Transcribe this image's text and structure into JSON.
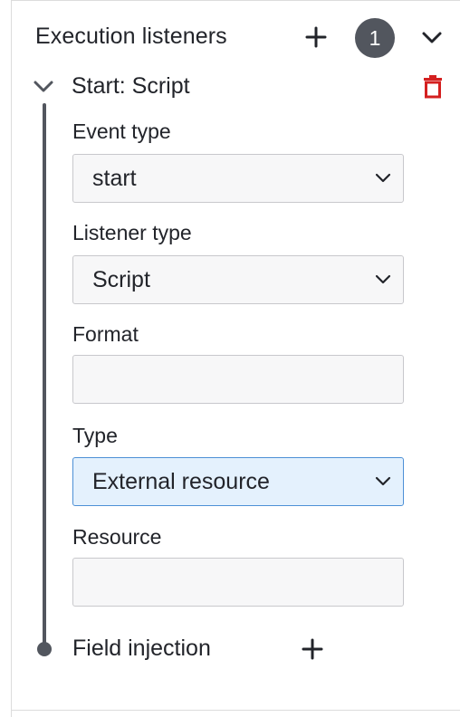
{
  "group": {
    "title": "Execution listeners",
    "count": "1",
    "add_icon": "plus-icon",
    "collapse_icon": "chevron-down-icon"
  },
  "entry": {
    "title": "Start: Script",
    "expand_icon": "chevron-down-icon",
    "delete_icon": "trash-icon",
    "delete_color": "#d42020"
  },
  "fields": {
    "event_type": {
      "label": "Event type",
      "value": "start"
    },
    "listener_type": {
      "label": "Listener type",
      "value": "Script"
    },
    "format": {
      "label": "Format",
      "value": ""
    },
    "type": {
      "label": "Type",
      "value": "External resource"
    },
    "resource": {
      "label": "Resource",
      "value": ""
    }
  },
  "field_injection": {
    "label": "Field injection",
    "add_icon": "plus-icon"
  },
  "colors": {
    "text": "#22242a",
    "badge": "#52565e",
    "focused_select_bg": "#e4f1fd",
    "focused_select_border": "#4d90d6"
  }
}
